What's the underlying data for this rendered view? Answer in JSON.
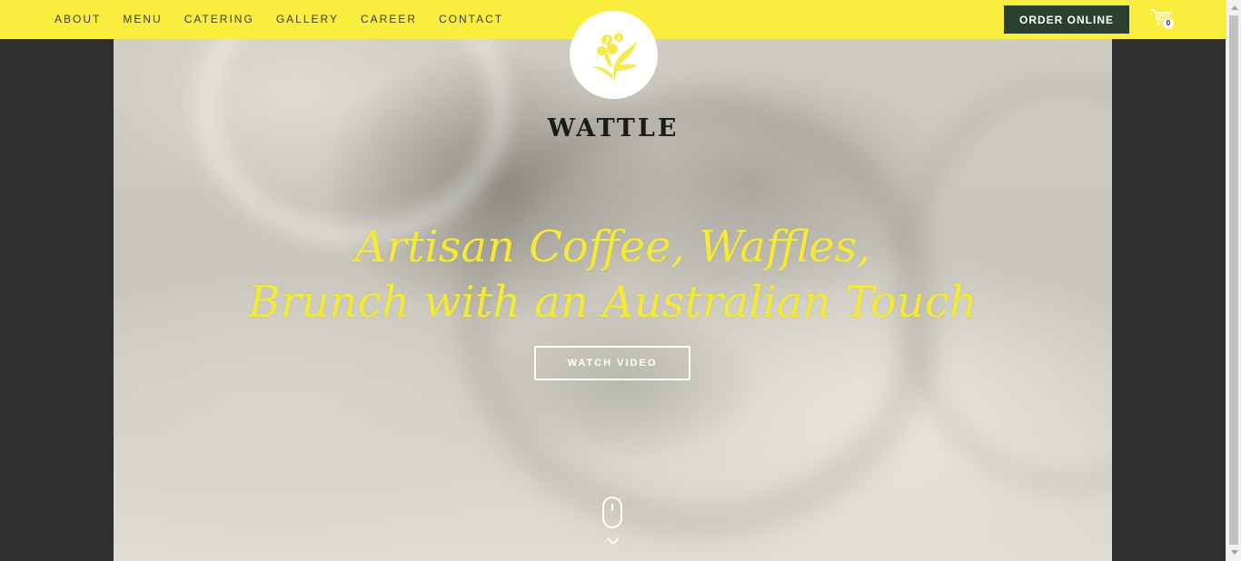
{
  "nav": {
    "items": [
      {
        "label": "ABOUT"
      },
      {
        "label": "MENU"
      },
      {
        "label": "CATERING"
      },
      {
        "label": "GALLERY"
      },
      {
        "label": "CAREER"
      },
      {
        "label": "CONTACT"
      }
    ],
    "order_label": "ORDER ONLINE",
    "cart_count": "0"
  },
  "brand": {
    "name": "WATTLE"
  },
  "hero": {
    "headline_line1": "Artisan Coffee, Waffles,",
    "headline_line2": "Brunch with an Australian Touch",
    "watch_label": "WATCH VIDEO"
  },
  "colors": {
    "topbar": "#f9ed3e",
    "order_button": "#2b4130",
    "headline": "#f4e93b",
    "page_background": "#2f2f2f"
  },
  "icons": {
    "cart": "cart-icon",
    "logo": "wattle-flower-icon",
    "scroll": "mouse-icon",
    "chevron": "chevron-down-icon"
  }
}
